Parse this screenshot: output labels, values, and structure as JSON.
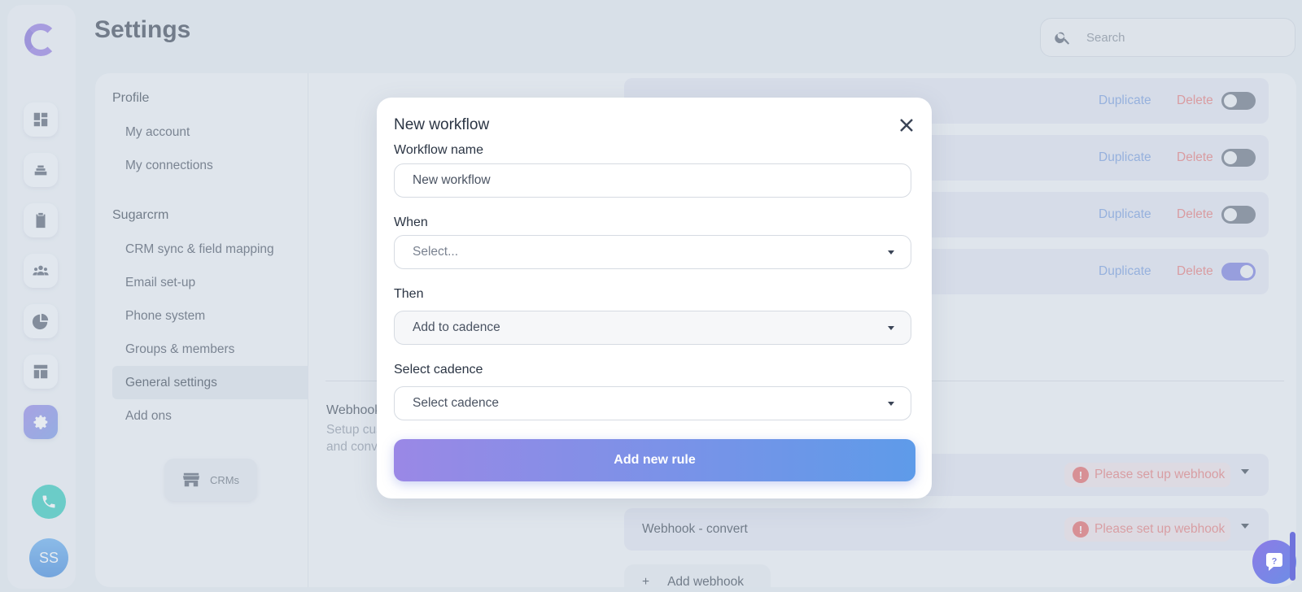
{
  "page": {
    "title": "Settings"
  },
  "search": {
    "placeholder": "Search"
  },
  "settings_nav": {
    "profile_section": "Profile",
    "profile_items": [
      "My account",
      "My connections"
    ],
    "crm_section": "Sugarcrm",
    "crm_items": [
      "CRM sync & field mapping",
      "Email set-up",
      "Phone system",
      "Groups & members",
      "General settings",
      "Add ons"
    ],
    "selected": "General settings",
    "crm_button": "CRMs"
  },
  "workflows": {
    "rows": [
      {
        "duplicate": "Duplicate",
        "delete": "Delete",
        "enabled": false
      },
      {
        "duplicate": "Duplicate",
        "delete": "Delete",
        "enabled": false
      },
      {
        "duplicate": "Duplicate",
        "delete": "Delete",
        "enabled": false
      },
      {
        "duplicate": "Duplicate",
        "delete": "Delete",
        "enabled": true
      }
    ]
  },
  "webhooks": {
    "title": "Webhook",
    "description": "Setup cus and conv",
    "rows": [
      {
        "name": "",
        "warning": "Please set up webhook"
      },
      {
        "name": "Webhook - convert",
        "warning": "Please set up webhook"
      }
    ],
    "add_label": "Add webhook"
  },
  "modal": {
    "title": "New workflow",
    "workflow_name_label": "Workflow name",
    "workflow_name_value": "New workflow",
    "when_label": "When",
    "when_placeholder": "Select...",
    "then_label": "Then",
    "then_value": "Add to cadence",
    "cadence_label": "Select cadence",
    "cadence_placeholder": "Select cadence",
    "submit_label": "Add new rule"
  },
  "user": {
    "initials": "SS"
  },
  "colors": {
    "accent": "#7b83e2",
    "danger": "#e57373",
    "link": "#6e95dc",
    "phone": "#1fc7b6"
  }
}
